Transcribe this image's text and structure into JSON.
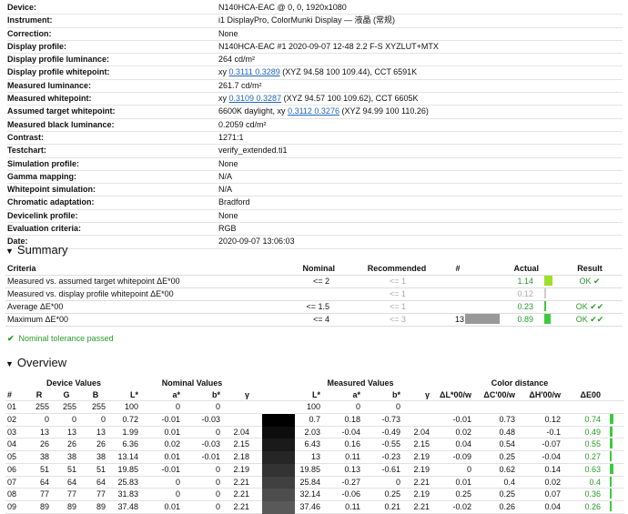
{
  "info": [
    {
      "label": "Device:",
      "value": "N140HCA-EAC @ 0, 0, 1920x1080"
    },
    {
      "label": "Instrument:",
      "value": "i1 DisplayPro, ColorMunki Display — 液晶 (常规)"
    },
    {
      "label": "Correction:",
      "value": "None"
    },
    {
      "label": "Display profile:",
      "value": "N140HCA-EAC #1 2020-09-07 12-48 2.2 F-S XYZLUT+MTX"
    },
    {
      "label": "Display profile luminance:",
      "value": "264 cd/m²"
    },
    {
      "label": "Display profile whitepoint:",
      "pre": "xy ",
      "link": "0.3111 0.3289",
      "post": " (XYZ 94.58 100 109.44), CCT 6591K"
    },
    {
      "label": "Measured luminance:",
      "value": "261.7 cd/m²"
    },
    {
      "label": "Measured whitepoint:",
      "pre": "xy ",
      "link": "0.3109 0.3287",
      "post": " (XYZ 94.57 100 109.62), CCT 6605K"
    },
    {
      "label": "Assumed target whitepoint:",
      "pre": "6600K daylight, xy ",
      "link": "0.3112 0.3276",
      "post": " (XYZ 94.99 100 110.26)"
    },
    {
      "label": "Measured black luminance:",
      "value": "0.2059 cd/m²"
    },
    {
      "label": "Contrast:",
      "value": "1271:1"
    },
    {
      "label": "Testchart:",
      "value": "verify_extended.ti1"
    },
    {
      "label": "Simulation profile:",
      "value": "None"
    },
    {
      "label": "Gamma mapping:",
      "value": "N/A"
    },
    {
      "label": "Whitepoint simulation:",
      "value": "N/A"
    },
    {
      "label": "Chromatic adaptation:",
      "value": "Bradford"
    },
    {
      "label": "Devicelink profile:",
      "value": "None"
    },
    {
      "label": "Evaluation criteria:",
      "value": "RGB"
    },
    {
      "label": "Date:",
      "value": "2020-09-07 13:06:03"
    }
  ],
  "summary": {
    "title": "Summary",
    "headers": {
      "criteria": "Criteria",
      "nominal": "Nominal",
      "recommended": "Recommended",
      "count": "#",
      "actual": "Actual",
      "result": "Result"
    },
    "rows": [
      {
        "criteria": "Measured vs. assumed target whitepoint ΔE*00",
        "nominal": "<= 2",
        "recommended": "<= 1",
        "count": "",
        "actual": "1.14",
        "result": "OK ✔",
        "bar_color": "#9fe02a",
        "bar_fraction": 0.57,
        "grey_bar": 0
      },
      {
        "criteria": "Measured vs. display profile whitepoint ΔE*00",
        "nominal": "",
        "recommended": "<= 1",
        "count": "",
        "actual": "0.12",
        "result": "",
        "bar_color": "#cccccc",
        "bar_fraction": 0.06,
        "grey_bar": 0
      },
      {
        "criteria": "Average ΔE*00",
        "nominal": "<= 1.5",
        "recommended": "<= 1",
        "count": "",
        "actual": "0.23",
        "result": "OK ✔✔",
        "bar_color": "#3ec93e",
        "bar_fraction": 0.12,
        "grey_bar": 0
      },
      {
        "criteria": "Maximum ΔE*00",
        "nominal": "<= 4",
        "recommended": "<= 3",
        "count": "13",
        "actual": "0.89",
        "result": "OK ✔✔",
        "bar_color": "#3ec93e",
        "bar_fraction": 0.45,
        "grey_bar": 1
      }
    ],
    "passed": "Nominal tolerance passed"
  },
  "overview": {
    "title": "Overview",
    "groups": {
      "device": "Device Values",
      "nominal": "Nominal Values",
      "measured": "Measured Values",
      "color_distance": "Color distance"
    },
    "headers": [
      "#",
      "R",
      "G",
      "B",
      "L*",
      "a*",
      "b*",
      "γ",
      "L*",
      "a*",
      "b*",
      "γ",
      "ΔL*00/w",
      "ΔC'00/w",
      "ΔH'00/w",
      "ΔE00"
    ],
    "rows": [
      {
        "n": "01",
        "R": "255",
        "G": "255",
        "B": "255",
        "nL": "100",
        "na": "0",
        "nb": "0",
        "ng": "",
        "mL": "100",
        "ma": "0",
        "mb": "0",
        "mg": "",
        "dL": "",
        "dC": "",
        "dH": "",
        "dE": "",
        "swatch": "#ffffff",
        "dEv": 0
      },
      {
        "n": "02",
        "R": "0",
        "G": "0",
        "B": "0",
        "nL": "0.72",
        "na": "-0.01",
        "nb": "-0.03",
        "ng": "",
        "mL": "0.7",
        "ma": "0.18",
        "mb": "-0.73",
        "mg": "",
        "dL": "-0.01",
        "dC": "0.73",
        "dH": "0.12",
        "dE": "0.74",
        "swatch": "#000000",
        "dEv": 0.74
      },
      {
        "n": "03",
        "R": "13",
        "G": "13",
        "B": "13",
        "nL": "1.99",
        "na": "0.01",
        "nb": "0",
        "ng": "2.04",
        "mL": "2.03",
        "ma": "-0.04",
        "mb": "-0.49",
        "mg": "2.04",
        "dL": "0.02",
        "dC": "0.48",
        "dH": "-0.1",
        "dE": "0.49",
        "swatch": "#0d0d0d",
        "dEv": 0.49
      },
      {
        "n": "04",
        "R": "26",
        "G": "26",
        "B": "26",
        "nL": "6.36",
        "na": "0.02",
        "nb": "-0.03",
        "ng": "2.15",
        "mL": "6.43",
        "ma": "0.16",
        "mb": "-0.55",
        "mg": "2.15",
        "dL": "0.04",
        "dC": "0.54",
        "dH": "-0.07",
        "dE": "0.55",
        "swatch": "#1a1a1a",
        "dEv": 0.55
      },
      {
        "n": "05",
        "R": "38",
        "G": "38",
        "B": "38",
        "nL": "13.14",
        "na": "0.01",
        "nb": "-0.01",
        "ng": "2.18",
        "mL": "13",
        "ma": "0.11",
        "mb": "-0.23",
        "mg": "2.19",
        "dL": "-0.09",
        "dC": "0.25",
        "dH": "-0.04",
        "dE": "0.27",
        "swatch": "#262626",
        "dEv": 0.27
      },
      {
        "n": "06",
        "R": "51",
        "G": "51",
        "B": "51",
        "nL": "19.85",
        "na": "-0.01",
        "nb": "0",
        "ng": "2.19",
        "mL": "19.85",
        "ma": "0.13",
        "mb": "-0.61",
        "mg": "2.19",
        "dL": "0",
        "dC": "0.62",
        "dH": "0.14",
        "dE": "0.63",
        "swatch": "#333333",
        "dEv": 0.63
      },
      {
        "n": "07",
        "R": "64",
        "G": "64",
        "B": "64",
        "nL": "25.83",
        "na": "0",
        "nb": "0",
        "ng": "2.21",
        "mL": "25.84",
        "ma": "-0.27",
        "mb": "0",
        "mg": "2.21",
        "dL": "0.01",
        "dC": "0.4",
        "dH": "0.02",
        "dE": "0.4",
        "swatch": "#404040",
        "dEv": 0.4
      },
      {
        "n": "08",
        "R": "77",
        "G": "77",
        "B": "77",
        "nL": "31.83",
        "na": "0",
        "nb": "0",
        "ng": "2.21",
        "mL": "32.14",
        "ma": "-0.06",
        "mb": "0.25",
        "mg": "2.19",
        "dL": "0.25",
        "dC": "0.25",
        "dH": "0.07",
        "dE": "0.36",
        "swatch": "#4d4d4d",
        "dEv": 0.36
      },
      {
        "n": "09",
        "R": "89",
        "G": "89",
        "B": "89",
        "nL": "37.48",
        "na": "0.01",
        "nb": "0",
        "ng": "2.21",
        "mL": "37.46",
        "ma": "0.11",
        "mb": "0.21",
        "mg": "2.21",
        "dL": "-0.02",
        "dC": "0.26",
        "dH": "0.04",
        "dE": "0.26",
        "swatch": "#595959",
        "dEv": 0.26
      }
    ]
  }
}
